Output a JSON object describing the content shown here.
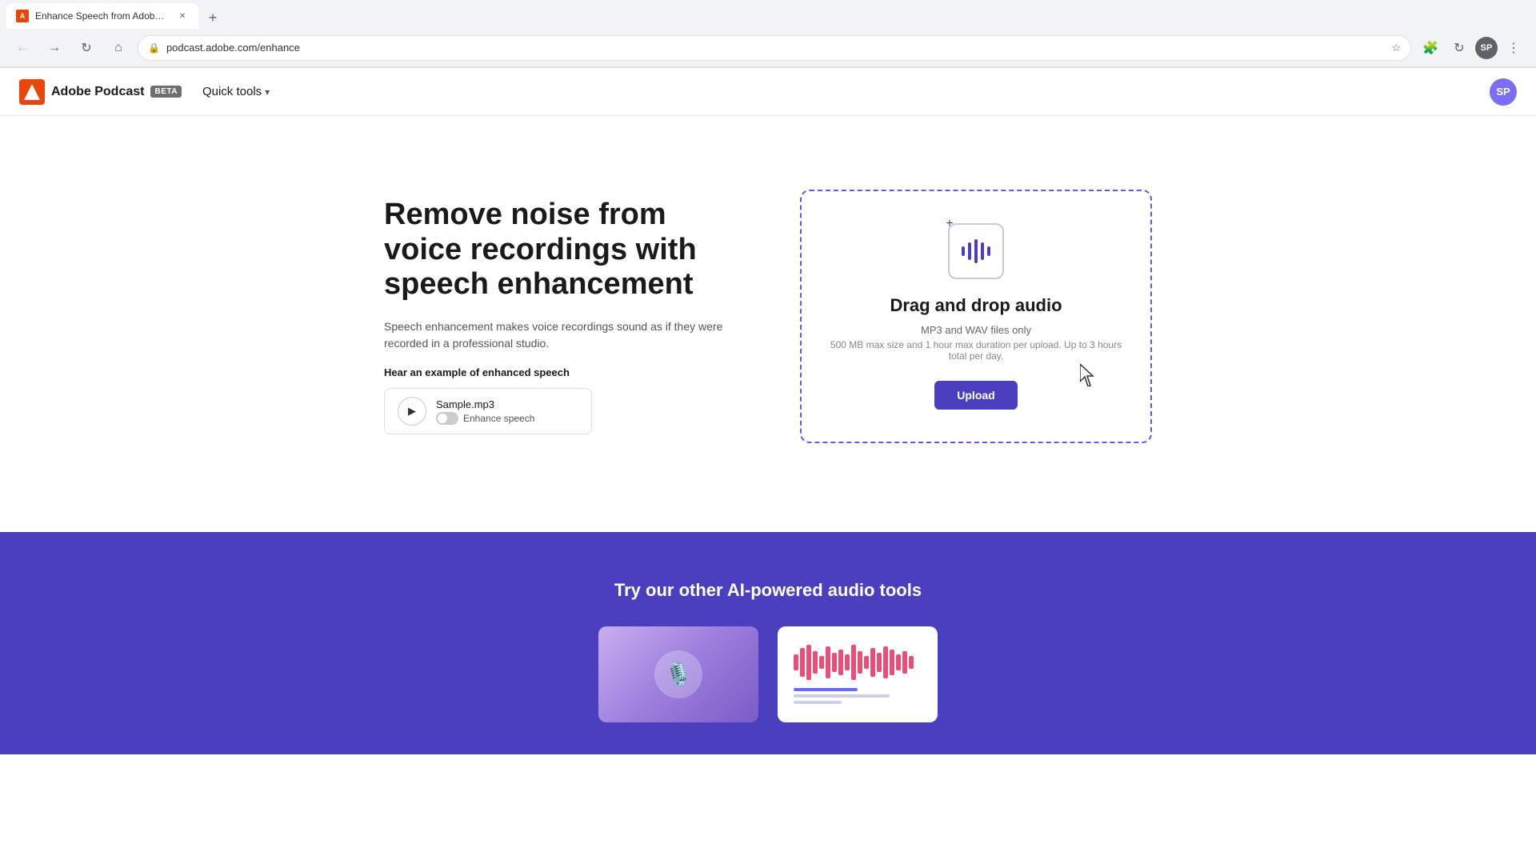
{
  "browser": {
    "tab_title": "Enhance Speech from Adobe | F...",
    "tab_favicon": "A",
    "address": "podcast.adobe.com/enhance",
    "profile_initials": "SP",
    "new_tab_label": "+"
  },
  "header": {
    "adobe_logo_text": "A",
    "app_name": "Adobe Podcast",
    "beta_label": "BETA",
    "quick_tools_label": "Quick tools",
    "user_initials": "SP"
  },
  "hero": {
    "title": "Remove noise from voice recordings with speech enhancement",
    "description": "Speech enhancement makes voice recordings sound as if they were recorded in a professional studio.",
    "hear_example_label": "Hear an example of enhanced speech",
    "sample_filename": "Sample.mp3",
    "enhance_speech_label": "Enhance speech"
  },
  "upload_zone": {
    "drag_drop_title": "Drag and drop audio",
    "file_types": "MP3 and WAV files only",
    "size_limit": "500 MB max size and 1 hour max duration per upload. Up to 3 hours total per day.",
    "upload_button_label": "Upload"
  },
  "bottom_section": {
    "title": "Try our other AI-powered audio tools"
  },
  "colors": {
    "brand_purple": "#4a3fbf",
    "dashed_border": "#6857e6",
    "adobe_red": "#e8460b"
  }
}
